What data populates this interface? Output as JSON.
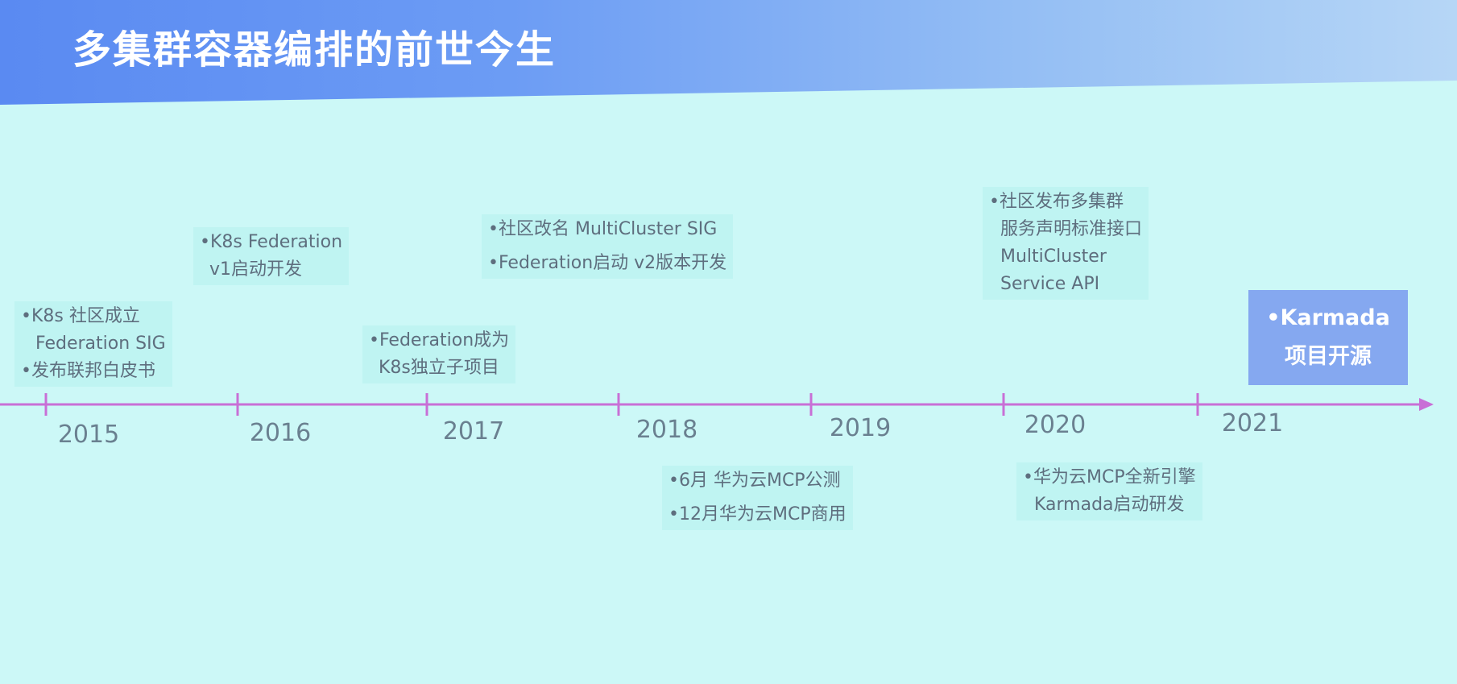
{
  "title": "多集群容器编排的前世今生",
  "colors": {
    "accent_line": "#c86fd6",
    "highlight_bg": "#85a8f0",
    "header_start": "#5a8af2",
    "background": "#ccf8f7"
  },
  "timeline": {
    "years": [
      "2015",
      "2016",
      "2017",
      "2018",
      "2019",
      "2020",
      "2021"
    ],
    "events_above": [
      {
        "year": "2015",
        "lines": [
          "•K8s 社区成立",
          "  Federation SIG",
          "•发布联邦白皮书"
        ]
      },
      {
        "year": "2016",
        "lines": [
          "•K8s Federation",
          "  v1启动开发"
        ]
      },
      {
        "year": "2017",
        "lines": [
          "•Federation成为",
          "  K8s独立子项目"
        ]
      },
      {
        "year": "2017-2018",
        "lines": [
          "•社区改名 MultiCluster SIG",
          "•Federation启动 v2版本开发"
        ]
      },
      {
        "year": "2020",
        "lines": [
          "•社区发布多集群",
          "  服务声明标准接口",
          "  MultiCluster",
          "  Service API"
        ]
      }
    ],
    "events_below": [
      {
        "year": "2018",
        "lines": [
          "•6月 华为云MCP公测",
          "•12月华为云MCP商用"
        ]
      },
      {
        "year": "2020",
        "lines": [
          "•华为云MCP全新引擎",
          "  Karmada启动研发"
        ]
      }
    ],
    "highlight": {
      "year": "2021",
      "lines": [
        "•Karmada",
        "项目开源"
      ]
    }
  }
}
